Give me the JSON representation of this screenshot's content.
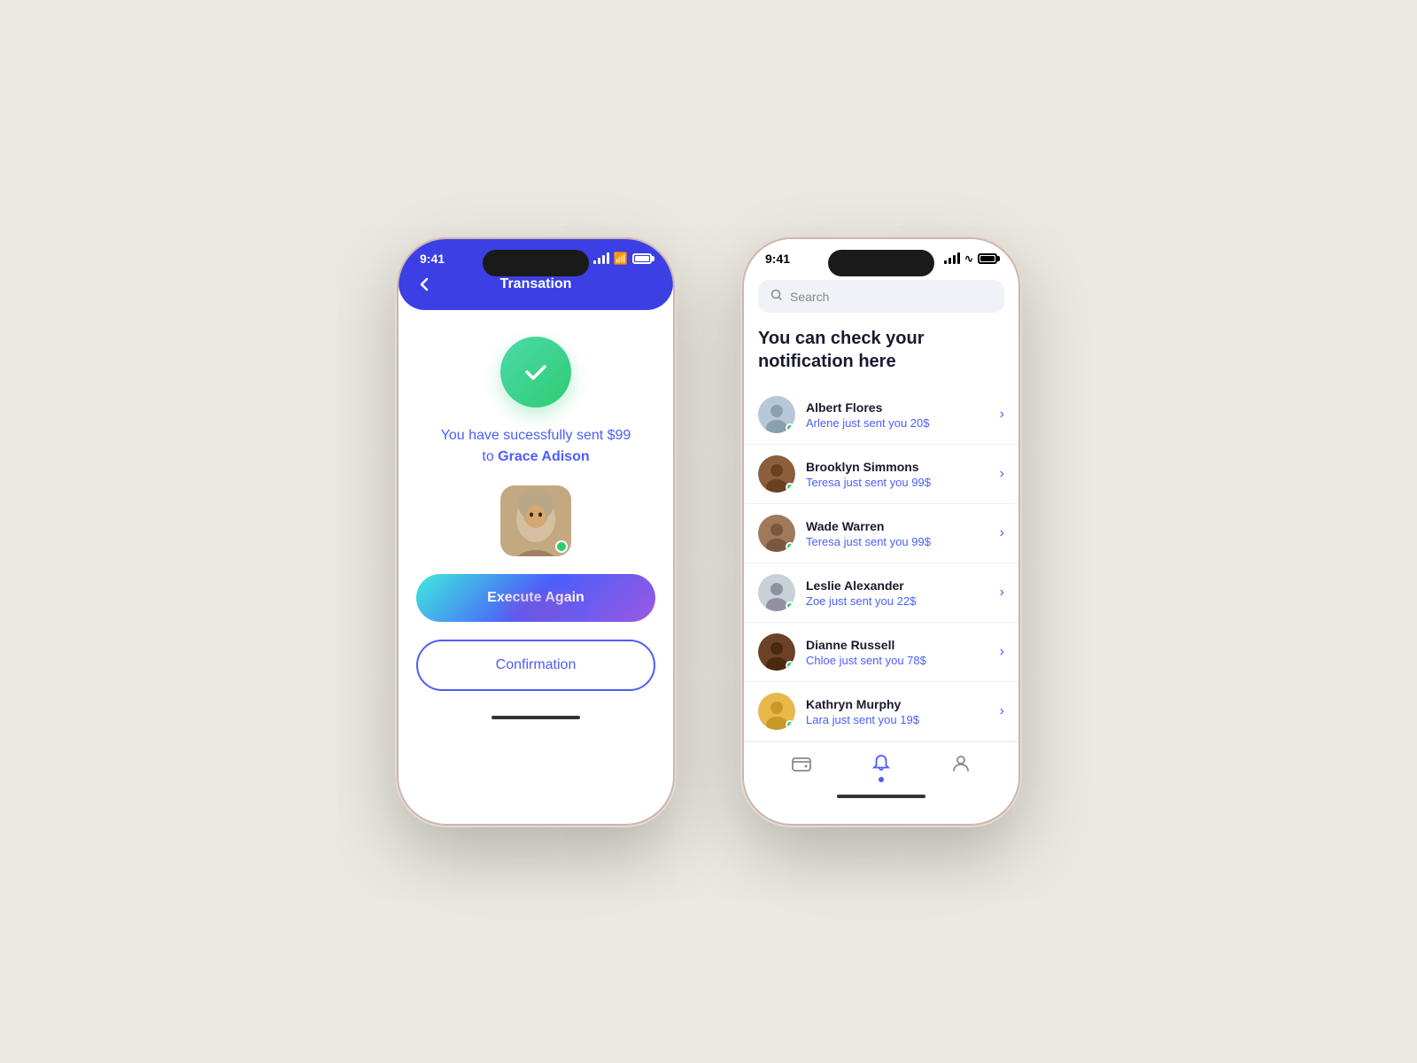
{
  "background": "#eae8e0",
  "phone_left": {
    "status_time": "9:41",
    "header_title": "Transation",
    "back_label": "←",
    "success_message_line1": "You have sucessfully sent $99",
    "success_message_line2": "to",
    "success_name": "Grace Adison",
    "execute_btn_label": "Execute Again",
    "confirmation_btn_label": "Confirmation"
  },
  "phone_right": {
    "status_time": "9:41",
    "search_placeholder": "Search",
    "notification_title_line1": "You can check your",
    "notification_title_line2": "notification here",
    "notifications": [
      {
        "id": 1,
        "name": "Albert Flores",
        "message": "Arlene just sent you 20$",
        "dot_color": "#2ECC71",
        "face_emoji": "👤",
        "bg": "#b8c8d8"
      },
      {
        "id": 2,
        "name": "Brooklyn Simmons",
        "message": "Teresa just sent you 99$",
        "dot_color": "#2ECC71",
        "face_emoji": "👤",
        "bg": "#8B5E3C"
      },
      {
        "id": 3,
        "name": "Wade Warren",
        "message": "Teresa just sent you 99$",
        "dot_color": "#2ECC71",
        "face_emoji": "👤",
        "bg": "#A0785A"
      },
      {
        "id": 4,
        "name": "Leslie Alexander",
        "message": "Zoe just sent you 22$",
        "dot_color": "#2ECC71",
        "face_emoji": "👤",
        "bg": "#c8d0d8"
      },
      {
        "id": 5,
        "name": "Dianne Russell",
        "message": "Chloe just sent you 78$",
        "dot_color": "#2ECC71",
        "face_emoji": "👤",
        "bg": "#6B4226"
      },
      {
        "id": 6,
        "name": "Kathryn Murphy",
        "message": "Lara just sent you 19$",
        "dot_color": "#2ECC71",
        "face_emoji": "👤",
        "bg": "#E8B84B"
      }
    ],
    "nav_items": [
      {
        "icon": "🗂",
        "label": "wallet",
        "active": false
      },
      {
        "icon": "🔔",
        "label": "notifications",
        "active": true
      },
      {
        "icon": "👤",
        "label": "profile",
        "active": false
      }
    ]
  }
}
